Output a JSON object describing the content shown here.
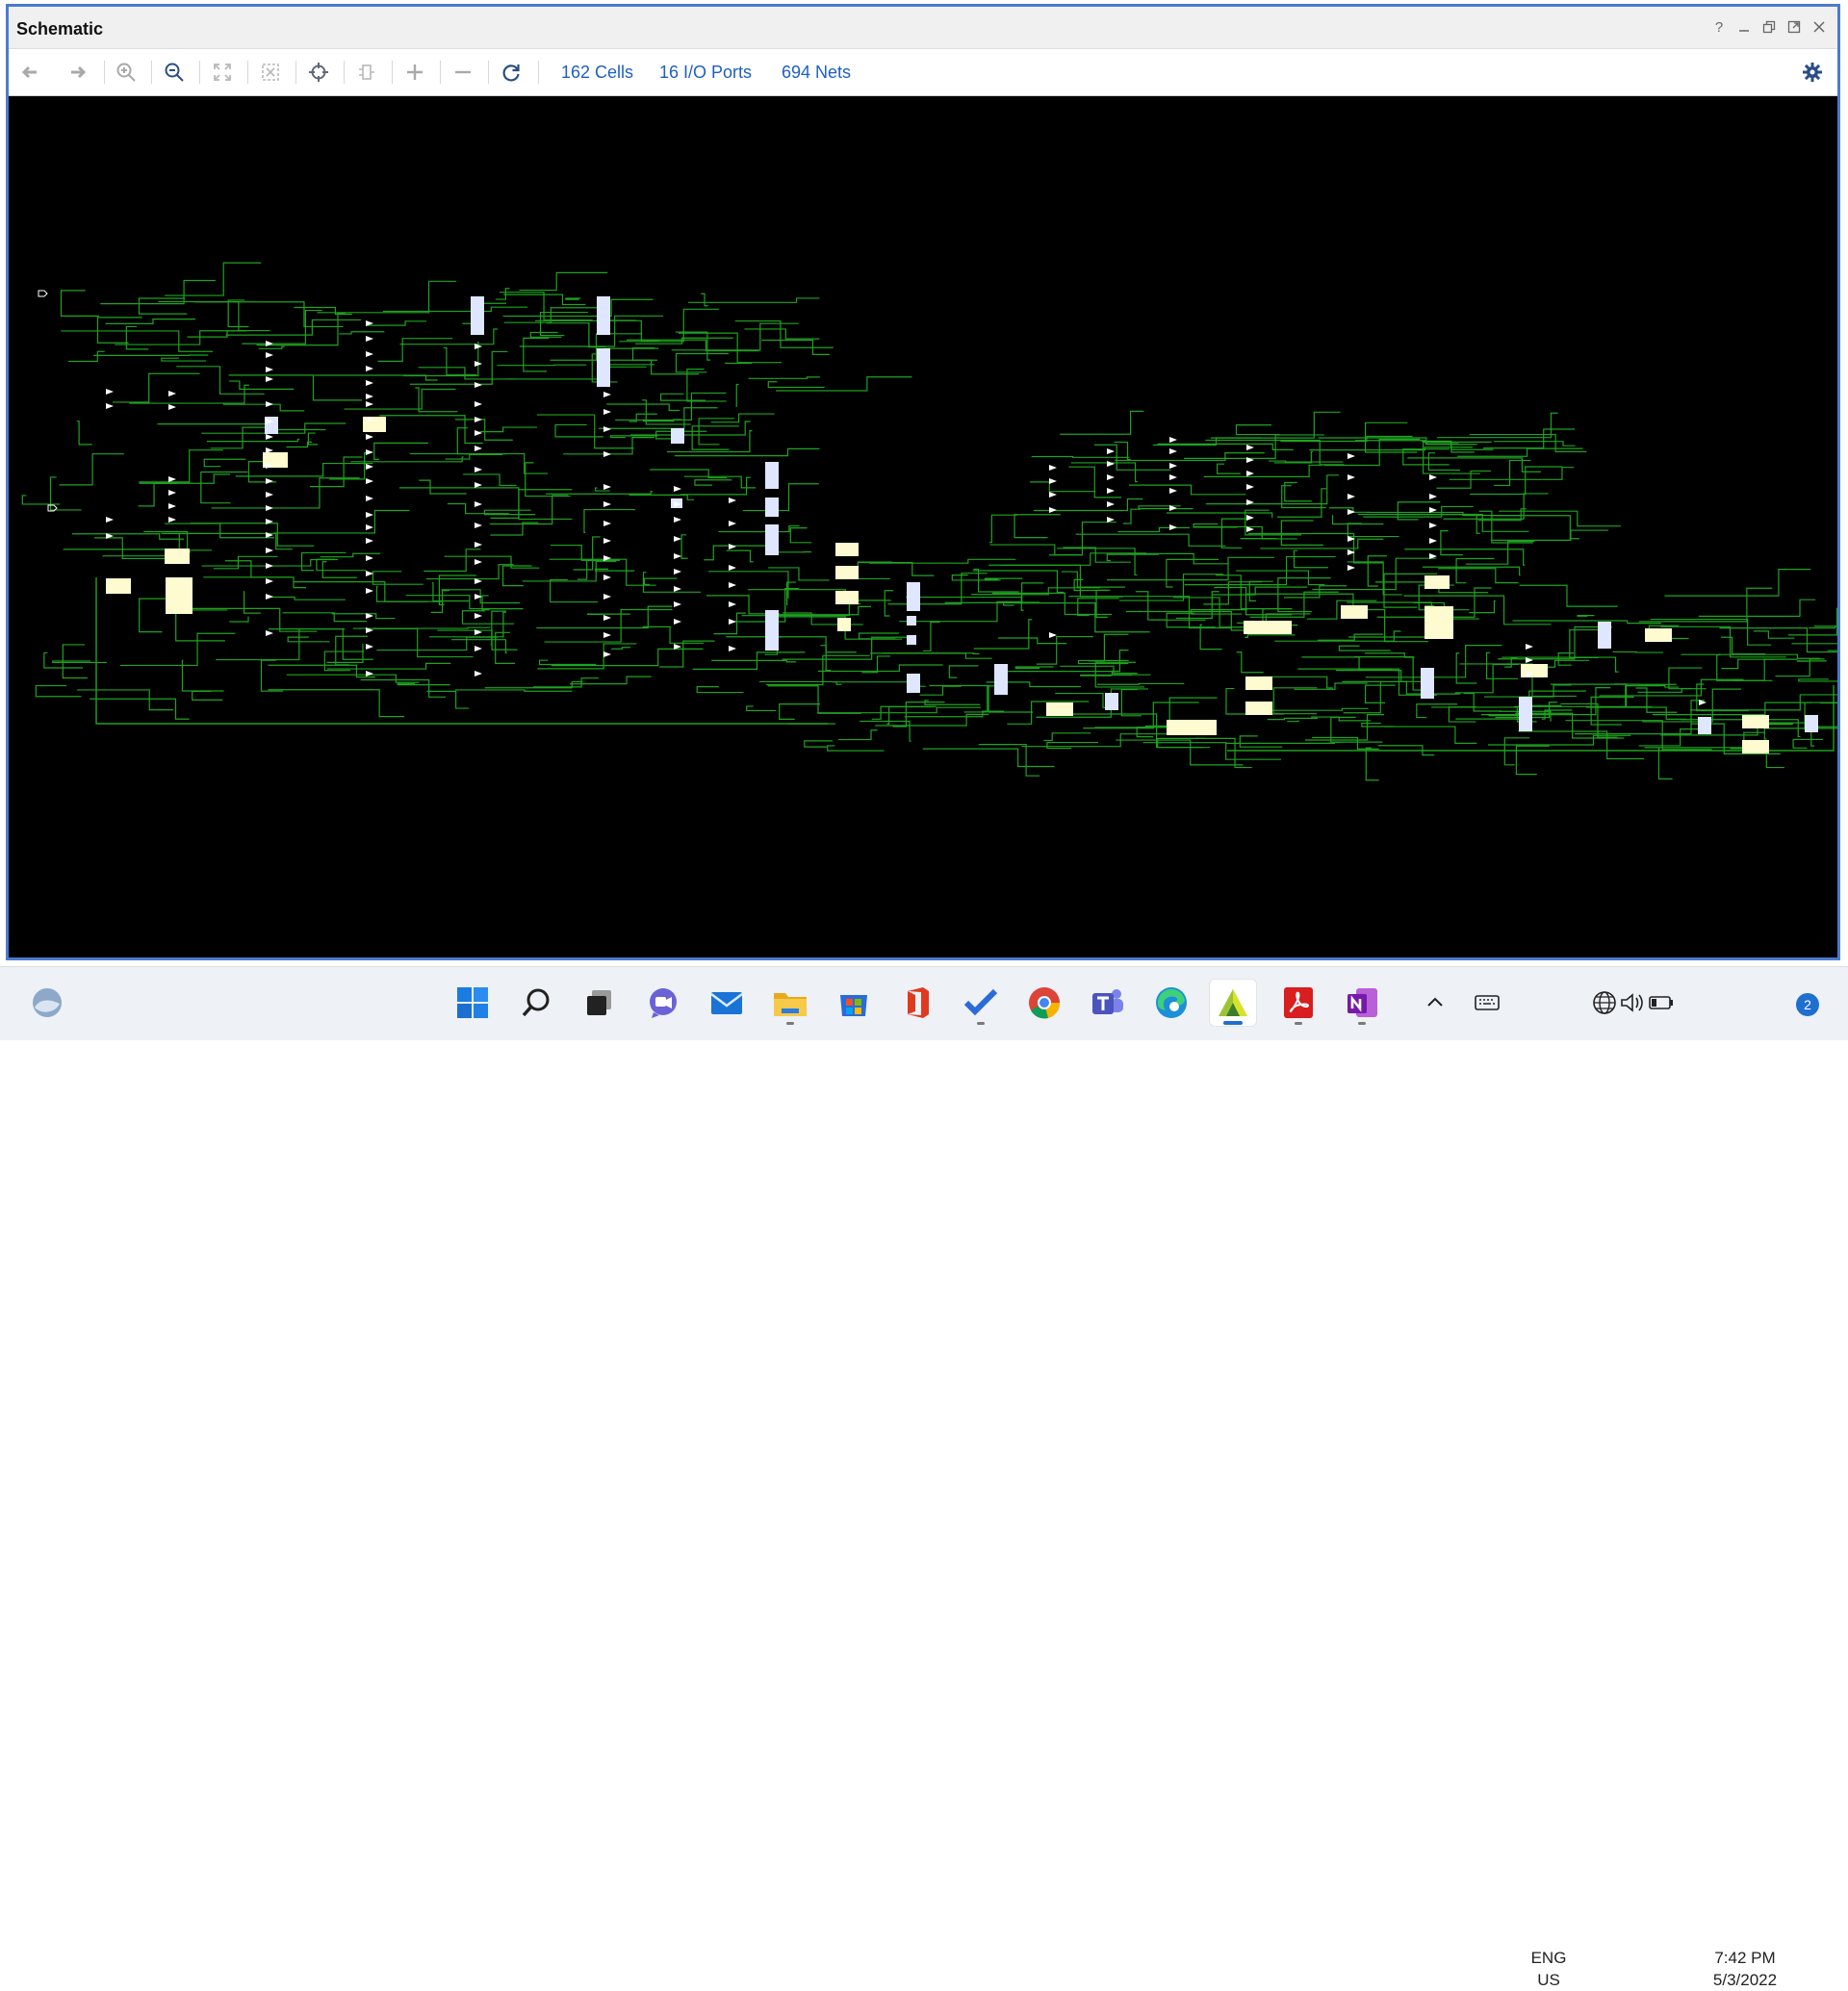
{
  "window": {
    "title": "Schematic"
  },
  "window_controls": [
    "?",
    "minimize",
    "float",
    "maximize",
    "close"
  ],
  "toolbar": {
    "buttons": [
      "back",
      "forward",
      "zoom-in",
      "zoom-out",
      "zoom-fit",
      "fit-selection",
      "auto-fit-selection",
      "toggle-cells",
      "expand",
      "collapse",
      "regenerate"
    ],
    "stats": {
      "cells": "162 Cells",
      "ports": "16 I/O Ports",
      "nets": "694 Nets"
    },
    "settings": "settings"
  },
  "schematic": {
    "background": "#000000",
    "net_color": "#1fa31f",
    "cell_color": "#fffbd0",
    "port_color": "#ffffff"
  },
  "taskbar": {
    "apps": [
      "widgets",
      "start",
      "search",
      "task-view",
      "chat",
      "mail",
      "file-explorer",
      "store",
      "office",
      "todo",
      "chrome",
      "teams",
      "edge",
      "vivado",
      "acrobat",
      "onenote"
    ],
    "tray": {
      "lang1": "ENG",
      "lang2": "US",
      "time": "7:42 PM",
      "date": "5/3/2022",
      "notifications": "2"
    }
  }
}
